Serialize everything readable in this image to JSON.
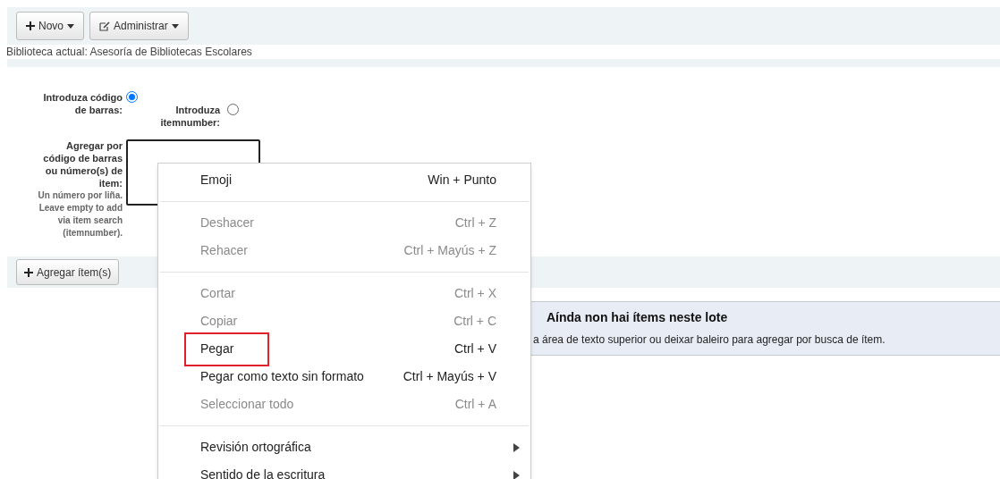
{
  "toolbar": {
    "buttons": [
      {
        "label": "Novo",
        "kind": "plus"
      },
      {
        "label": "Administrar",
        "kind": "edit"
      }
    ]
  },
  "current_library": "Biblioteca actual: Asesoría de Bibliotecas Escolares",
  "form": {
    "radios": [
      {
        "label": "Introduza código de barras:",
        "selected": true
      },
      {
        "label": "Introduza itemnumber:",
        "selected": false
      }
    ],
    "textarea_label": "Agregar por código de barras ou número(s) de item:",
    "hint": "Un número por liña. Leave empty to add via item search (itemnumber).",
    "submit": "Agregar ítem(s)"
  },
  "message": {
    "title": "Aínda non hai ítems neste lote",
    "text": "a área de texto superior ou deixar baleiro para agregar por busca de ítem."
  },
  "context_menu": [
    {
      "kind": "item",
      "label": "Emoji",
      "shortcut": "Win + Punto",
      "disabled": false,
      "highlighted": false
    },
    {
      "kind": "separator"
    },
    {
      "kind": "item",
      "label": "Deshacer",
      "shortcut": "Ctrl + Z",
      "disabled": true,
      "highlighted": false
    },
    {
      "kind": "item",
      "label": "Rehacer",
      "shortcut": "Ctrl + Mayús + Z",
      "disabled": true,
      "highlighted": false
    },
    {
      "kind": "separator"
    },
    {
      "kind": "item",
      "label": "Cortar",
      "shortcut": "Ctrl + X",
      "disabled": true,
      "highlighted": false
    },
    {
      "kind": "item",
      "label": "Copiar",
      "shortcut": "Ctrl + C",
      "disabled": true,
      "highlighted": false
    },
    {
      "kind": "item",
      "label": "Pegar",
      "shortcut": "Ctrl + V",
      "disabled": false,
      "highlighted": true
    },
    {
      "kind": "item",
      "label": "Pegar como texto sin formato",
      "shortcut": "Ctrl + Mayús + V",
      "disabled": false,
      "highlighted": false
    },
    {
      "kind": "item",
      "label": "Seleccionar todo",
      "shortcut": "Ctrl + A",
      "disabled": true,
      "highlighted": false
    },
    {
      "kind": "separator"
    },
    {
      "kind": "submenu",
      "label": "Revisión ortográfica",
      "disabled": false,
      "highlighted": false
    },
    {
      "kind": "submenu",
      "label": "Sentido de la escritura",
      "disabled": false,
      "highlighted": false
    }
  ]
}
